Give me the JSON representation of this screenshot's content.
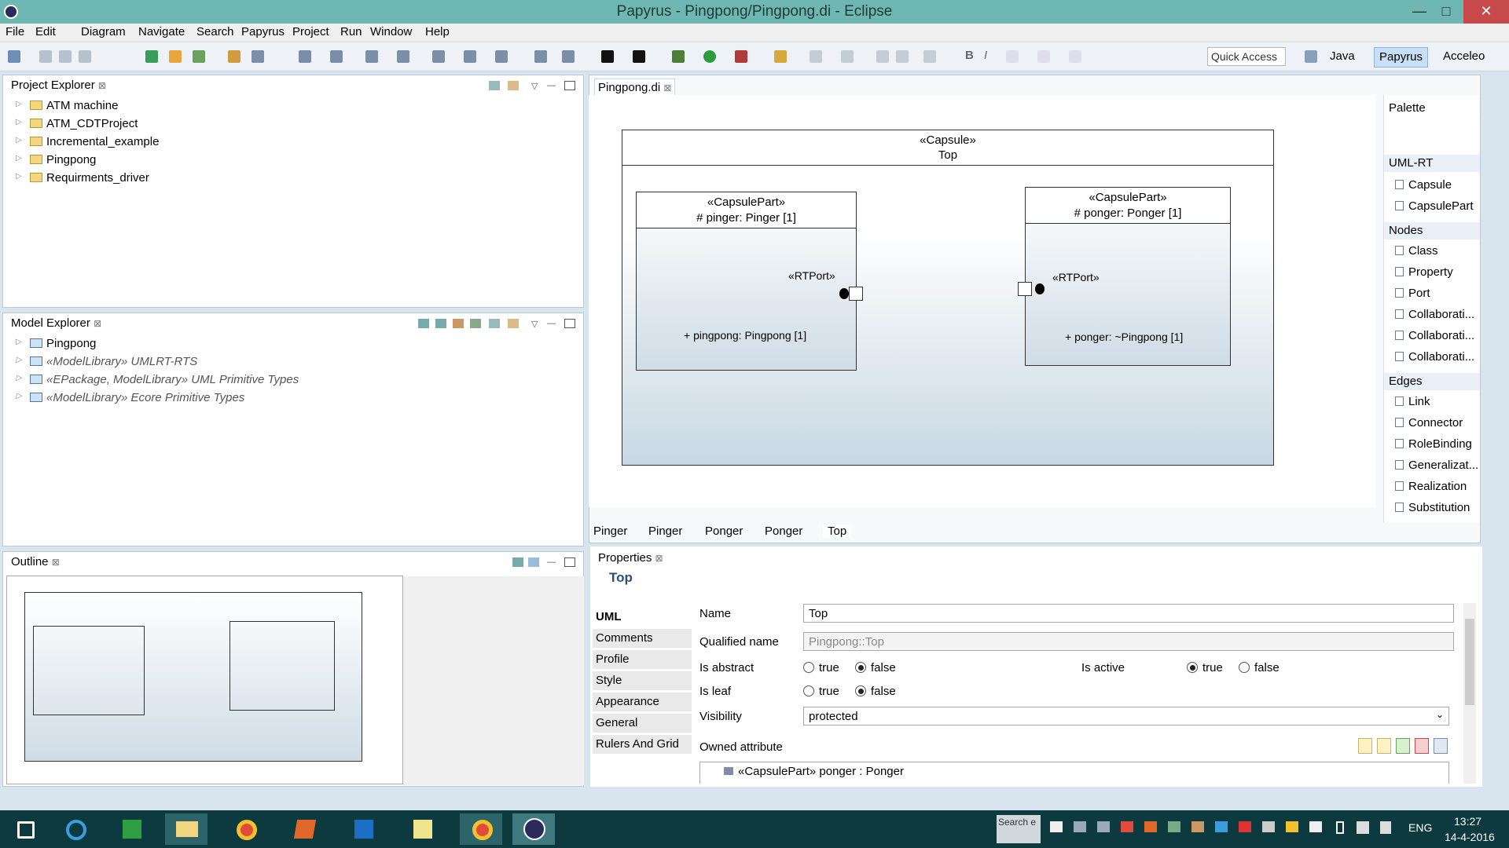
{
  "window": {
    "title": "Papyrus - Pingpong/Pingpong.di - Eclipse",
    "minimize": "—",
    "maximize": "□",
    "close": "✕"
  },
  "menu": [
    "File",
    "Edit",
    "Diagram",
    "Navigate",
    "Search",
    "Papyrus",
    "Project",
    "Run",
    "Window",
    "Help"
  ],
  "toolbar": {
    "quick_access": "Quick Access",
    "perspectives": [
      "Java",
      "Papyrus",
      "Acceleo"
    ],
    "bold": "B",
    "italic": "I"
  },
  "project_explorer": {
    "title": "Project Explorer",
    "items": [
      "ATM machine",
      "ATM_CDTProject",
      "Incremental_example",
      "Pingpong",
      "Requirments_driver"
    ]
  },
  "model_explorer": {
    "title": "Model Explorer",
    "items": [
      "Pingpong",
      "«ModelLibrary» UMLRT-RTS",
      "«EPackage, ModelLibrary» UML Primitive Types",
      "«ModelLibrary» Ecore Primitive Types"
    ]
  },
  "outline": {
    "title": "Outline"
  },
  "editor": {
    "tab": "Pingpong.di",
    "capsule": {
      "stereotype": "«Capsule»",
      "name": "Top"
    },
    "parts": [
      {
        "stereotype": "«CapsulePart»",
        "name": "# pinger: Pinger [1]",
        "port_stereo": "«RTPort»",
        "port": "+ pingpong: Pingpong [1]"
      },
      {
        "stereotype": "«CapsulePart»",
        "name": "# ponger: Ponger [1]",
        "port_stereo": "«RTPort»",
        "port": "+ ponger: ~Pingpong [1]"
      }
    ],
    "bottom_tabs": [
      "Pinger",
      "Pinger",
      "Ponger",
      "Ponger",
      "Top"
    ]
  },
  "palette": {
    "title": "Palette",
    "groups": [
      {
        "name": "UML-RT",
        "items": [
          "Capsule",
          "CapsulePart"
        ]
      },
      {
        "name": "Nodes",
        "items": [
          "Class",
          "Property",
          "Port",
          "Collaborati...",
          "Collaborati...",
          "Collaborati..."
        ]
      },
      {
        "name": "Edges",
        "items": [
          "Link",
          "Connector",
          "RoleBinding",
          "Generalizat...",
          "Realization",
          "Substitution"
        ]
      }
    ]
  },
  "properties": {
    "title": "Properties",
    "heading": "Top",
    "categories": [
      "UML",
      "Comments",
      "Profile",
      "Style",
      "Appearance",
      "General",
      "Rulers And Grid"
    ],
    "name_label": "Name",
    "name_value": "Top",
    "qname_label": "Qualified name",
    "qname_value": "Pingpong::Top",
    "abstract_label": "Is abstract",
    "active_label": "Is active",
    "leaf_label": "Is leaf",
    "true_label": "true",
    "false_label": "false",
    "visibility_label": "Visibility",
    "visibility_value": "protected",
    "owned_label": "Owned attribute",
    "owned_item": "«CapsulePart» ponger : Ponger"
  },
  "taskbar": {
    "search": "Search e",
    "lang": "ENG",
    "time": "13:27",
    "date": "14-4-2016"
  }
}
